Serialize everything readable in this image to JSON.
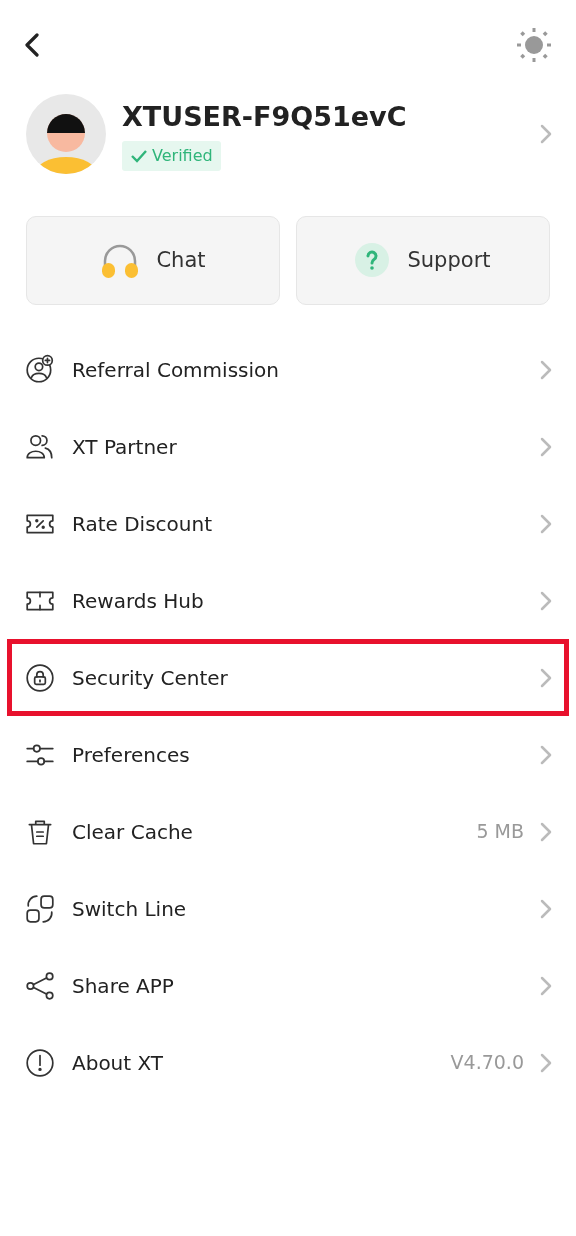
{
  "profile": {
    "username": "XTUSER-F9Q51evC",
    "badge": "Verified",
    "verified": true
  },
  "actions": [
    {
      "label": "Chat",
      "kind": "headset"
    },
    {
      "label": "Support",
      "kind": "help"
    }
  ],
  "menu": [
    {
      "label": "Referral Commission",
      "kind": "referral",
      "highlighted": false
    },
    {
      "label": "XT Partner",
      "kind": "partner",
      "highlighted": false
    },
    {
      "label": "Rate Discount",
      "kind": "discount",
      "highlighted": false
    },
    {
      "label": "Rewards Hub",
      "kind": "ticket",
      "highlighted": false
    },
    {
      "label": "Security Center",
      "kind": "lock",
      "highlighted": true
    },
    {
      "label": "Preferences",
      "kind": "sliders",
      "highlighted": false
    },
    {
      "label": "Clear Cache",
      "kind": "trash",
      "value": "5 MB",
      "highlighted": false
    },
    {
      "label": "Switch Line",
      "kind": "switch",
      "highlighted": false
    },
    {
      "label": "Share APP",
      "kind": "share",
      "highlighted": false
    },
    {
      "label": "About XT",
      "kind": "info",
      "value": "V4.70.0",
      "highlighted": false
    }
  ]
}
